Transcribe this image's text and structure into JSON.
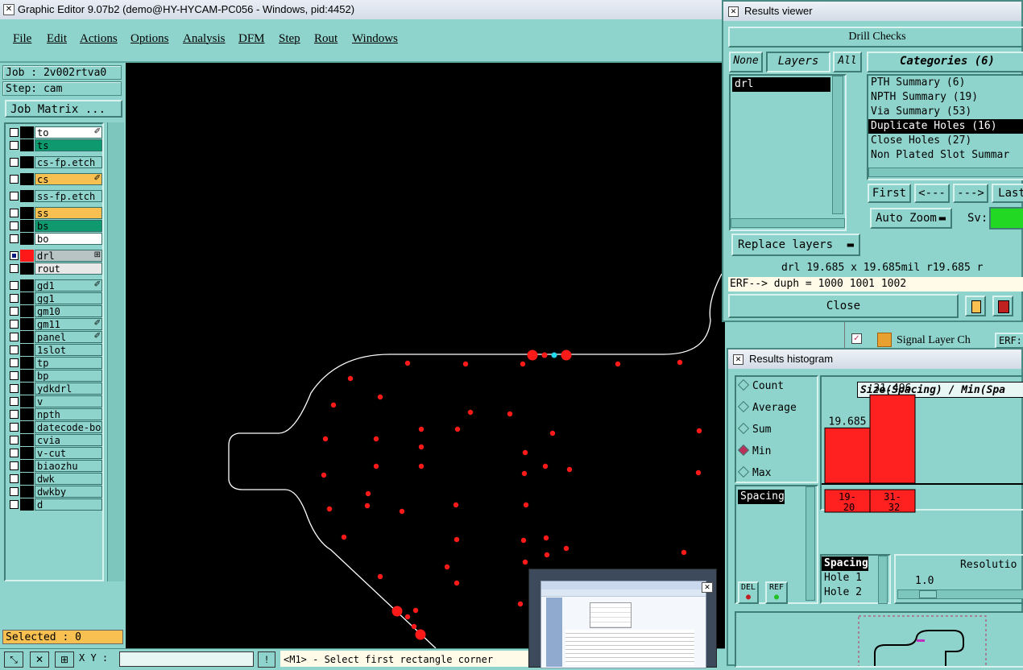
{
  "window": {
    "title": "Graphic Editor 9.07b2 (demo@HY-HYCAM-PC056 - Windows, pid:4452)"
  },
  "menu": [
    "File",
    "Edit",
    "Actions",
    "Options",
    "Analysis",
    "DFM",
    "Step",
    "Rout",
    "Windows"
  ],
  "left": {
    "job": "Job : 2v002rtva0",
    "step": "Step: cam",
    "job_matrix": "Job Matrix ...",
    "layers": [
      {
        "name": "to",
        "color": "#ffffff",
        "mark": "✐"
      },
      {
        "name": "ts",
        "color": "#0e9a6e",
        "mark": ""
      },
      {
        "name": "cs-fp.etch",
        "color": "#8fd4cc",
        "mark": ""
      },
      {
        "name": "cs",
        "color": "#f8c050",
        "mark": "✐"
      },
      {
        "name": "ss-fp.etch",
        "color": "#8fd4cc",
        "mark": ""
      },
      {
        "name": "ss",
        "color": "#f8c050",
        "mark": ""
      },
      {
        "name": "bs",
        "color": "#0e9a6e",
        "mark": ""
      },
      {
        "name": "bo",
        "color": "#ffffff",
        "mark": ""
      },
      {
        "name": "drl",
        "color": "#b8c4c4",
        "mark": "⊞"
      },
      {
        "name": "rout",
        "color": "#e8e8e8",
        "mark": ""
      },
      {
        "name": "gd1",
        "color": "#8fd4cc",
        "mark": "✐"
      },
      {
        "name": "gg1",
        "color": "#8fd4cc",
        "mark": ""
      },
      {
        "name": "gm10",
        "color": "#8fd4cc",
        "mark": ""
      },
      {
        "name": "gm11",
        "color": "#8fd4cc",
        "mark": "✐"
      },
      {
        "name": "panel",
        "color": "#8fd4cc",
        "mark": "✐"
      },
      {
        "name": "1slot",
        "color": "#8fd4cc",
        "mark": ""
      },
      {
        "name": "tp",
        "color": "#8fd4cc",
        "mark": ""
      },
      {
        "name": "bp",
        "color": "#8fd4cc",
        "mark": ""
      },
      {
        "name": "ydkdrl",
        "color": "#8fd4cc",
        "mark": ""
      },
      {
        "name": "v",
        "color": "#8fd4cc",
        "mark": ""
      },
      {
        "name": "npth",
        "color": "#8fd4cc",
        "mark": ""
      },
      {
        "name": "datecode-bo",
        "color": "#8fd4cc",
        "mark": ""
      },
      {
        "name": "cvia",
        "color": "#8fd4cc",
        "mark": ""
      },
      {
        "name": "v-cut",
        "color": "#8fd4cc",
        "mark": ""
      },
      {
        "name": "biaozhu",
        "color": "#8fd4cc",
        "mark": ""
      },
      {
        "name": "dwk",
        "color": "#8fd4cc",
        "mark": ""
      },
      {
        "name": "dwkby",
        "color": "#8fd4cc",
        "mark": ""
      },
      {
        "name": "d",
        "color": "#8fd4cc",
        "mark": ""
      }
    ],
    "selected": "Selected : 0"
  },
  "status": {
    "xy_label": "X Y :",
    "prompt": "<M1> - Select first rectangle corner",
    "info_icon": "!"
  },
  "results_viewer": {
    "title": "Results viewer",
    "header": "Drill Checks",
    "none": "None",
    "layers": "Layers",
    "all": "All",
    "categories_title": "Categories (6)",
    "layer_items": [
      "drl"
    ],
    "categories": [
      "PTH Summary (6)",
      "NPTH Summary (19)",
      "Via Summary (53)",
      "Duplicate Holes (16)",
      "Close Holes (27)",
      "Non Plated Slot Summar"
    ],
    "selected_category": "Duplicate Holes (16)",
    "nav": [
      "First",
      "<---",
      "--->",
      "Last"
    ],
    "auto_zoom": "Auto Zoom",
    "sv_label": "Sv:",
    "replace_layers": "Replace layers",
    "info_line": "drl  19.685 x 19.685mil  r19.685  r",
    "erf_line": "ERF--> duph = 1000 1001 1002",
    "close": "Close"
  },
  "behind_strip": {
    "text": "Signal Layer Ch",
    "erf": "ERF:"
  },
  "histogram": {
    "title": "Results histogram",
    "modes": [
      "Count",
      "Average",
      "Sum",
      "Min",
      "Max"
    ],
    "selected_mode": "Min",
    "chart_title": "Size(Spacing) / Min(Spa",
    "list1": [
      "Spacing"
    ],
    "list2": [
      "Spacing",
      "Hole 1",
      "Hole 2"
    ],
    "del": "DEL",
    "ref": "REF",
    "resolution_label": "Resolutio",
    "resolution_value": "1.0",
    "chart_data": {
      "type": "bar",
      "categories": [
        "19-20",
        "31-32"
      ],
      "values": [
        19.685,
        31.496
      ],
      "value_labels": [
        "19.685",
        "31.496"
      ],
      "bar_color": "#ff2020"
    }
  }
}
